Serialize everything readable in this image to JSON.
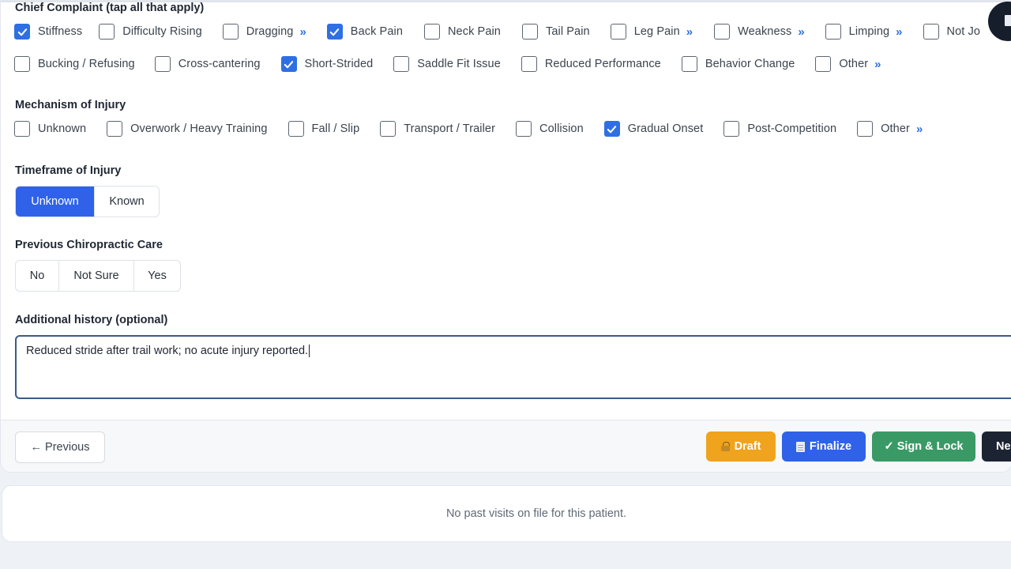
{
  "chief_complaint": {
    "title": "Chief Complaint (tap all that apply)",
    "row1": [
      {
        "label": "Stiffness",
        "checked": true,
        "more": false
      },
      {
        "label": "Difficulty Rising",
        "checked": false,
        "more": false
      },
      {
        "label": "Dragging",
        "checked": false,
        "more": true
      },
      {
        "label": "Back Pain",
        "checked": true,
        "more": false
      },
      {
        "label": "Neck Pain",
        "checked": false,
        "more": false
      },
      {
        "label": "Tail Pain",
        "checked": false,
        "more": false
      },
      {
        "label": "Leg Pain",
        "checked": false,
        "more": true
      },
      {
        "label": "Weakness",
        "checked": false,
        "more": true
      },
      {
        "label": "Limping",
        "checked": false,
        "more": true
      },
      {
        "label": "Not Jo",
        "checked": false,
        "more": false
      }
    ],
    "row2": [
      {
        "label": "Bucking / Refusing",
        "checked": false,
        "more": false
      },
      {
        "label": "Cross-cantering",
        "checked": false,
        "more": false
      },
      {
        "label": "Short-Strided",
        "checked": true,
        "more": false
      },
      {
        "label": "Saddle Fit Issue",
        "checked": false,
        "more": false
      },
      {
        "label": "Reduced Performance",
        "checked": false,
        "more": false
      },
      {
        "label": "Behavior Change",
        "checked": false,
        "more": false
      },
      {
        "label": "Other",
        "checked": false,
        "more": true
      }
    ]
  },
  "mechanism": {
    "title": "Mechanism of Injury",
    "items": [
      {
        "label": "Unknown",
        "checked": false,
        "more": false
      },
      {
        "label": "Overwork / Heavy Training",
        "checked": false,
        "more": false
      },
      {
        "label": "Fall / Slip",
        "checked": false,
        "more": false
      },
      {
        "label": "Transport / Trailer",
        "checked": false,
        "more": false
      },
      {
        "label": "Collision",
        "checked": false,
        "more": false
      },
      {
        "label": "Gradual Onset",
        "checked": true,
        "more": false
      },
      {
        "label": "Post-Competition",
        "checked": false,
        "more": false
      },
      {
        "label": "Other",
        "checked": false,
        "more": true
      }
    ]
  },
  "timeframe": {
    "title": "Timeframe of Injury",
    "options": [
      {
        "label": "Unknown",
        "active": true
      },
      {
        "label": "Known",
        "active": false
      }
    ]
  },
  "previous_care": {
    "title": "Previous Chiropractic Care",
    "options": [
      {
        "label": "No",
        "active": false
      },
      {
        "label": "Not Sure",
        "active": false
      },
      {
        "label": "Yes",
        "active": false
      }
    ]
  },
  "additional_history": {
    "title": "Additional history (optional)",
    "value": "Reduced stride after trail work; no acute injury reported."
  },
  "more_glyph": "»",
  "footer": {
    "previous_label": "← Previous",
    "draft_label": "Draft",
    "finalize_label": "Finalize",
    "sign_label": "✓ Sign & Lock",
    "next_label": "Ne"
  },
  "history": {
    "empty_text": "No past visits on file for this patient."
  },
  "colors": {
    "accent": "#2f62e8",
    "draft": "#f0a31d",
    "sign": "#3a9a66",
    "dark": "#1c2433"
  }
}
